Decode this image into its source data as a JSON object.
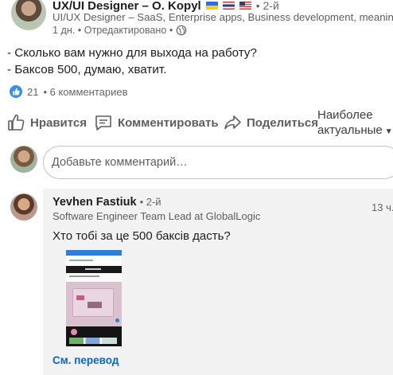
{
  "post": {
    "author_name": "UX/UI Designer – O. Kopyl",
    "degree": "• 2-й",
    "headline": "UI/UX Designer – SaaS, Enterprise apps, Business development, meaningful",
    "meta": "1 дн. • Отредактировано •",
    "text_line1": "- Сколько вам нужно для выхода на работу?",
    "text_line2": "- Баксов 500, думаю, хватит.",
    "reactions_count": "21",
    "comments_count": "• 6 комментариев"
  },
  "actions": {
    "like": "Нравится",
    "comment": "Комментировать",
    "share": "Поделиться",
    "sort_line1": "Наиболее",
    "sort_line2": "актуальные"
  },
  "composer": {
    "placeholder": "Добавьте комментарий…"
  },
  "comment": {
    "author_name": "Yevhen Fastiuk",
    "degree": "• 2-й",
    "headline": "Software Engineer Team Lead at GlobalLogic",
    "time": "13 ч.",
    "text": "Хто тобі за це 500 баксів дасть?",
    "translate_link": "См. перевод"
  },
  "icons": {
    "globe": "globe-icon",
    "like": "thumbs-up-icon",
    "comment": "comment-icon",
    "share": "share-arrow-icon",
    "sort": "caret-down-icon"
  },
  "colors": {
    "link": "#0a66c2",
    "like_badge": "#378fe9",
    "comment_bg": "#f2f2f2"
  }
}
